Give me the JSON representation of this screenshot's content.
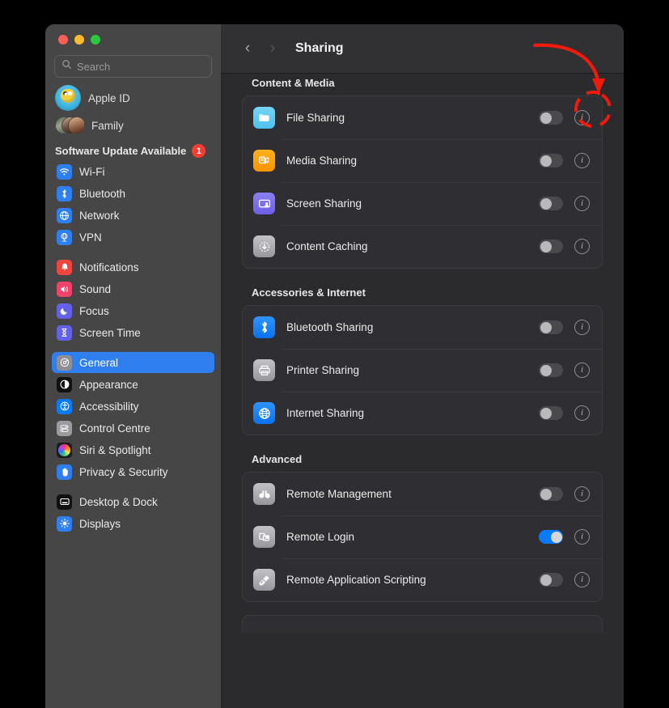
{
  "window": {
    "traffic_lights": [
      "close",
      "minimize",
      "zoom"
    ],
    "accent_color": "#0a7aff",
    "selected_color": "#2f7ff0"
  },
  "sidebar": {
    "search": {
      "placeholder": "Search",
      "value": ""
    },
    "accounts": [
      {
        "label": "Apple ID",
        "avatar": "apple-id-avatar"
      },
      {
        "label": "Family",
        "avatar": "family-avatar"
      }
    ],
    "update": {
      "label": "Software Update Available",
      "badge": "1"
    },
    "groups": [
      {
        "items": [
          {
            "label": "Wi-Fi",
            "icon": "wifi-icon"
          },
          {
            "label": "Bluetooth",
            "icon": "bluetooth-icon"
          },
          {
            "label": "Network",
            "icon": "network-icon"
          },
          {
            "label": "VPN",
            "icon": "vpn-icon"
          }
        ]
      },
      {
        "items": [
          {
            "label": "Notifications",
            "icon": "bell-icon"
          },
          {
            "label": "Sound",
            "icon": "speaker-icon"
          },
          {
            "label": "Focus",
            "icon": "moon-icon"
          },
          {
            "label": "Screen Time",
            "icon": "hourglass-icon"
          }
        ]
      },
      {
        "items": [
          {
            "label": "General",
            "icon": "gear-icon",
            "selected": true
          },
          {
            "label": "Appearance",
            "icon": "appearance-icon"
          },
          {
            "label": "Accessibility",
            "icon": "accessibility-icon"
          },
          {
            "label": "Control Centre",
            "icon": "control-centre-icon"
          },
          {
            "label": "Siri & Spotlight",
            "icon": "siri-icon"
          },
          {
            "label": "Privacy & Security",
            "icon": "hand-icon"
          }
        ]
      },
      {
        "items": [
          {
            "label": "Desktop & Dock",
            "icon": "desktop-dock-icon"
          },
          {
            "label": "Displays",
            "icon": "displays-icon"
          }
        ]
      }
    ]
  },
  "titlebar": {
    "back": "‹",
    "forward": "›",
    "title": "Sharing"
  },
  "main": {
    "sections": [
      {
        "title": "Content & Media",
        "clipped": true,
        "rows": [
          {
            "label": "File Sharing",
            "icon": "folder-icon",
            "enabled": false,
            "highlighted": true
          },
          {
            "label": "Media Sharing",
            "icon": "media-icon",
            "enabled": false
          },
          {
            "label": "Screen Sharing",
            "icon": "screen-share-icon",
            "enabled": false
          },
          {
            "label": "Content Caching",
            "icon": "download-icon",
            "enabled": false
          }
        ]
      },
      {
        "title": "Accessories & Internet",
        "rows": [
          {
            "label": "Bluetooth Sharing",
            "icon": "bluetooth-icon",
            "enabled": false
          },
          {
            "label": "Printer Sharing",
            "icon": "printer-icon",
            "enabled": false
          },
          {
            "label": "Internet Sharing",
            "icon": "globe-icon",
            "enabled": false
          }
        ]
      },
      {
        "title": "Advanced",
        "rows": [
          {
            "label": "Remote Management",
            "icon": "binoculars-icon",
            "enabled": false
          },
          {
            "label": "Remote Login",
            "icon": "terminal-icon",
            "enabled": true
          },
          {
            "label": "Remote Application Scripting",
            "icon": "script-icon",
            "enabled": false
          }
        ]
      }
    ],
    "info_glyph": "i"
  },
  "annotation": {
    "color": "#f01b0c",
    "type": "arrow-and-dashed-circle",
    "target": "file-sharing-info-button"
  }
}
